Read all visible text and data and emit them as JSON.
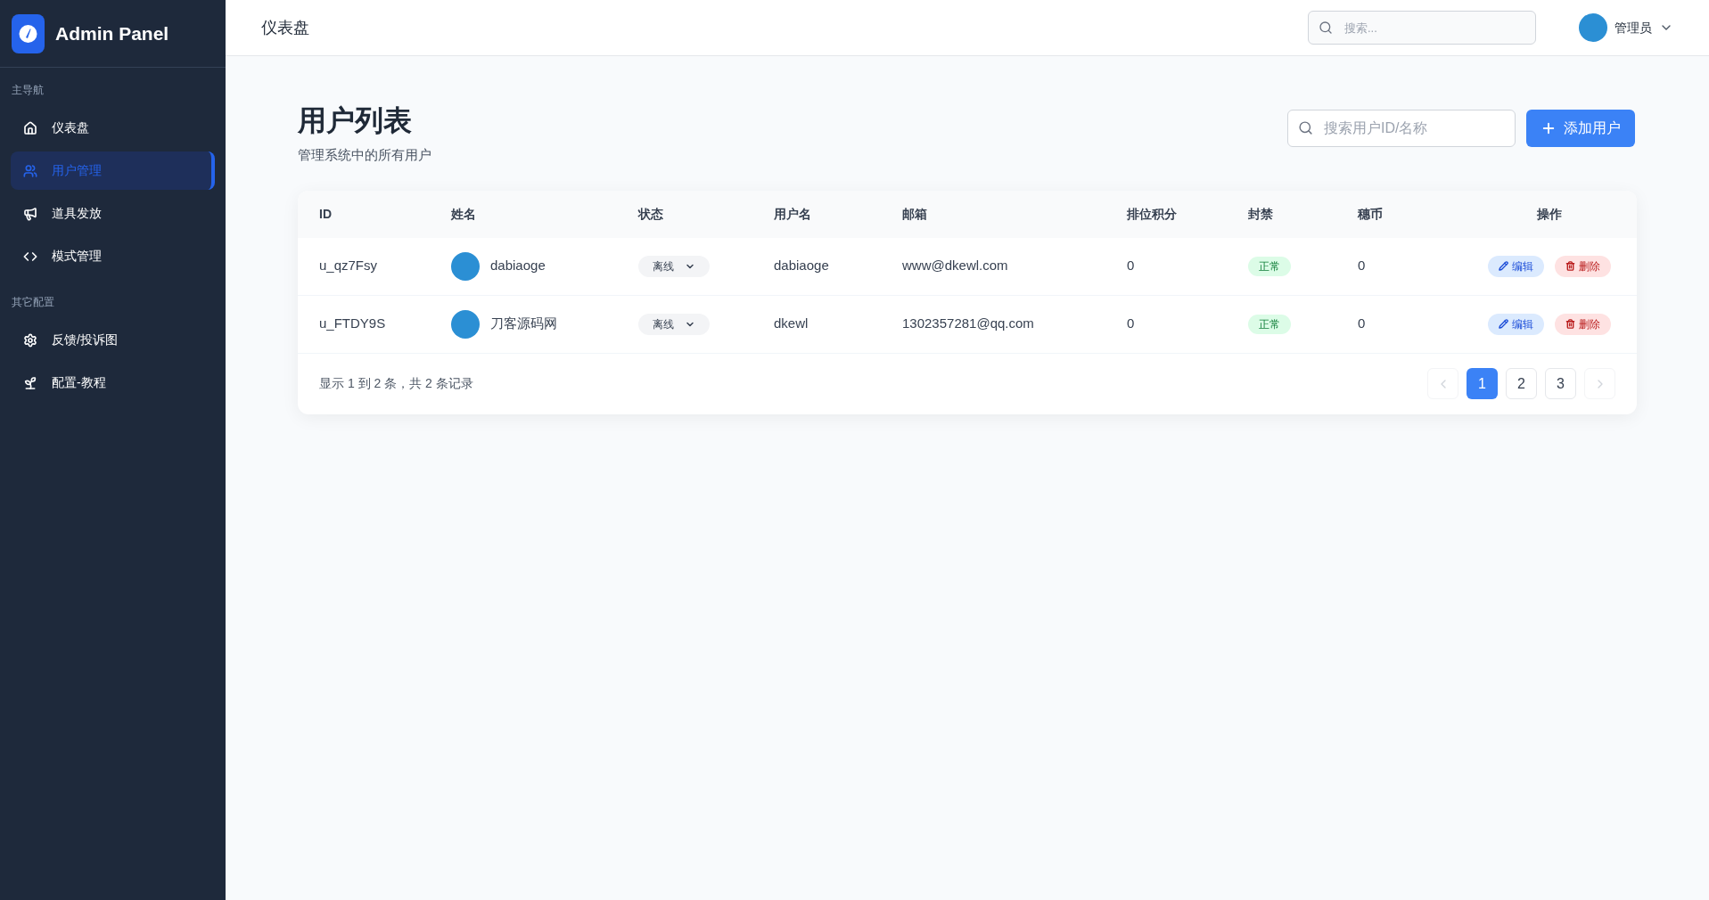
{
  "sidebar": {
    "logo_text": "Admin Panel",
    "sections": [
      {
        "title": "主导航",
        "items": [
          {
            "label": "仪表盘",
            "kind": "home",
            "selected": false
          },
          {
            "label": "用户管理",
            "kind": "users",
            "selected": true
          },
          {
            "label": "道具发放",
            "kind": "megaphone",
            "selected": false
          },
          {
            "label": "模式管理",
            "kind": "code",
            "selected": false
          }
        ]
      },
      {
        "title": "其它配置",
        "items": [
          {
            "label": "反馈/投诉图",
            "kind": "gear",
            "selected": false
          },
          {
            "label": "配置-教程",
            "kind": "sprout",
            "selected": false
          }
        ]
      }
    ]
  },
  "header": {
    "title": "仪表盘",
    "search": {
      "placeholder": "搜索..."
    },
    "user": {
      "name": "管理员"
    }
  },
  "page": {
    "title": "用户列表",
    "subtitle": "管理系统中的所有用户",
    "search": {
      "placeholder": "搜索用户ID/名称"
    },
    "add_button": "添加用户"
  },
  "table": {
    "columns": [
      "ID",
      "姓名",
      "状态",
      "用户名",
      "邮箱",
      "排位积分",
      "封禁",
      "穗币",
      "操作"
    ],
    "rows": [
      {
        "id": "u_qz7Fsy",
        "name": "dabiaoge",
        "status": "离线",
        "username": "dabiaoge",
        "email": "www@dkewl.com",
        "score": "0",
        "ban": {
          "text": "正常",
          "kind": "normal"
        },
        "coins": "0",
        "edit": "编辑",
        "delete": "删除"
      },
      {
        "id": "u_FTDY9S",
        "name": "刀客源码网",
        "status": "离线",
        "username": "dkewl",
        "email": "1302357281@qq.com",
        "score": "0",
        "ban": {
          "text": "正常",
          "kind": "normal"
        },
        "coins": "0",
        "edit": "编辑",
        "delete": "删除"
      }
    ]
  },
  "pagination": {
    "summary": "显示 1 到 2 条，共 2 条记录",
    "prev_disabled": true,
    "next_disabled": true,
    "pages": [
      {
        "label": "1",
        "selected": true
      },
      {
        "label": "2",
        "selected": false
      },
      {
        "label": "3",
        "selected": false
      }
    ]
  }
}
